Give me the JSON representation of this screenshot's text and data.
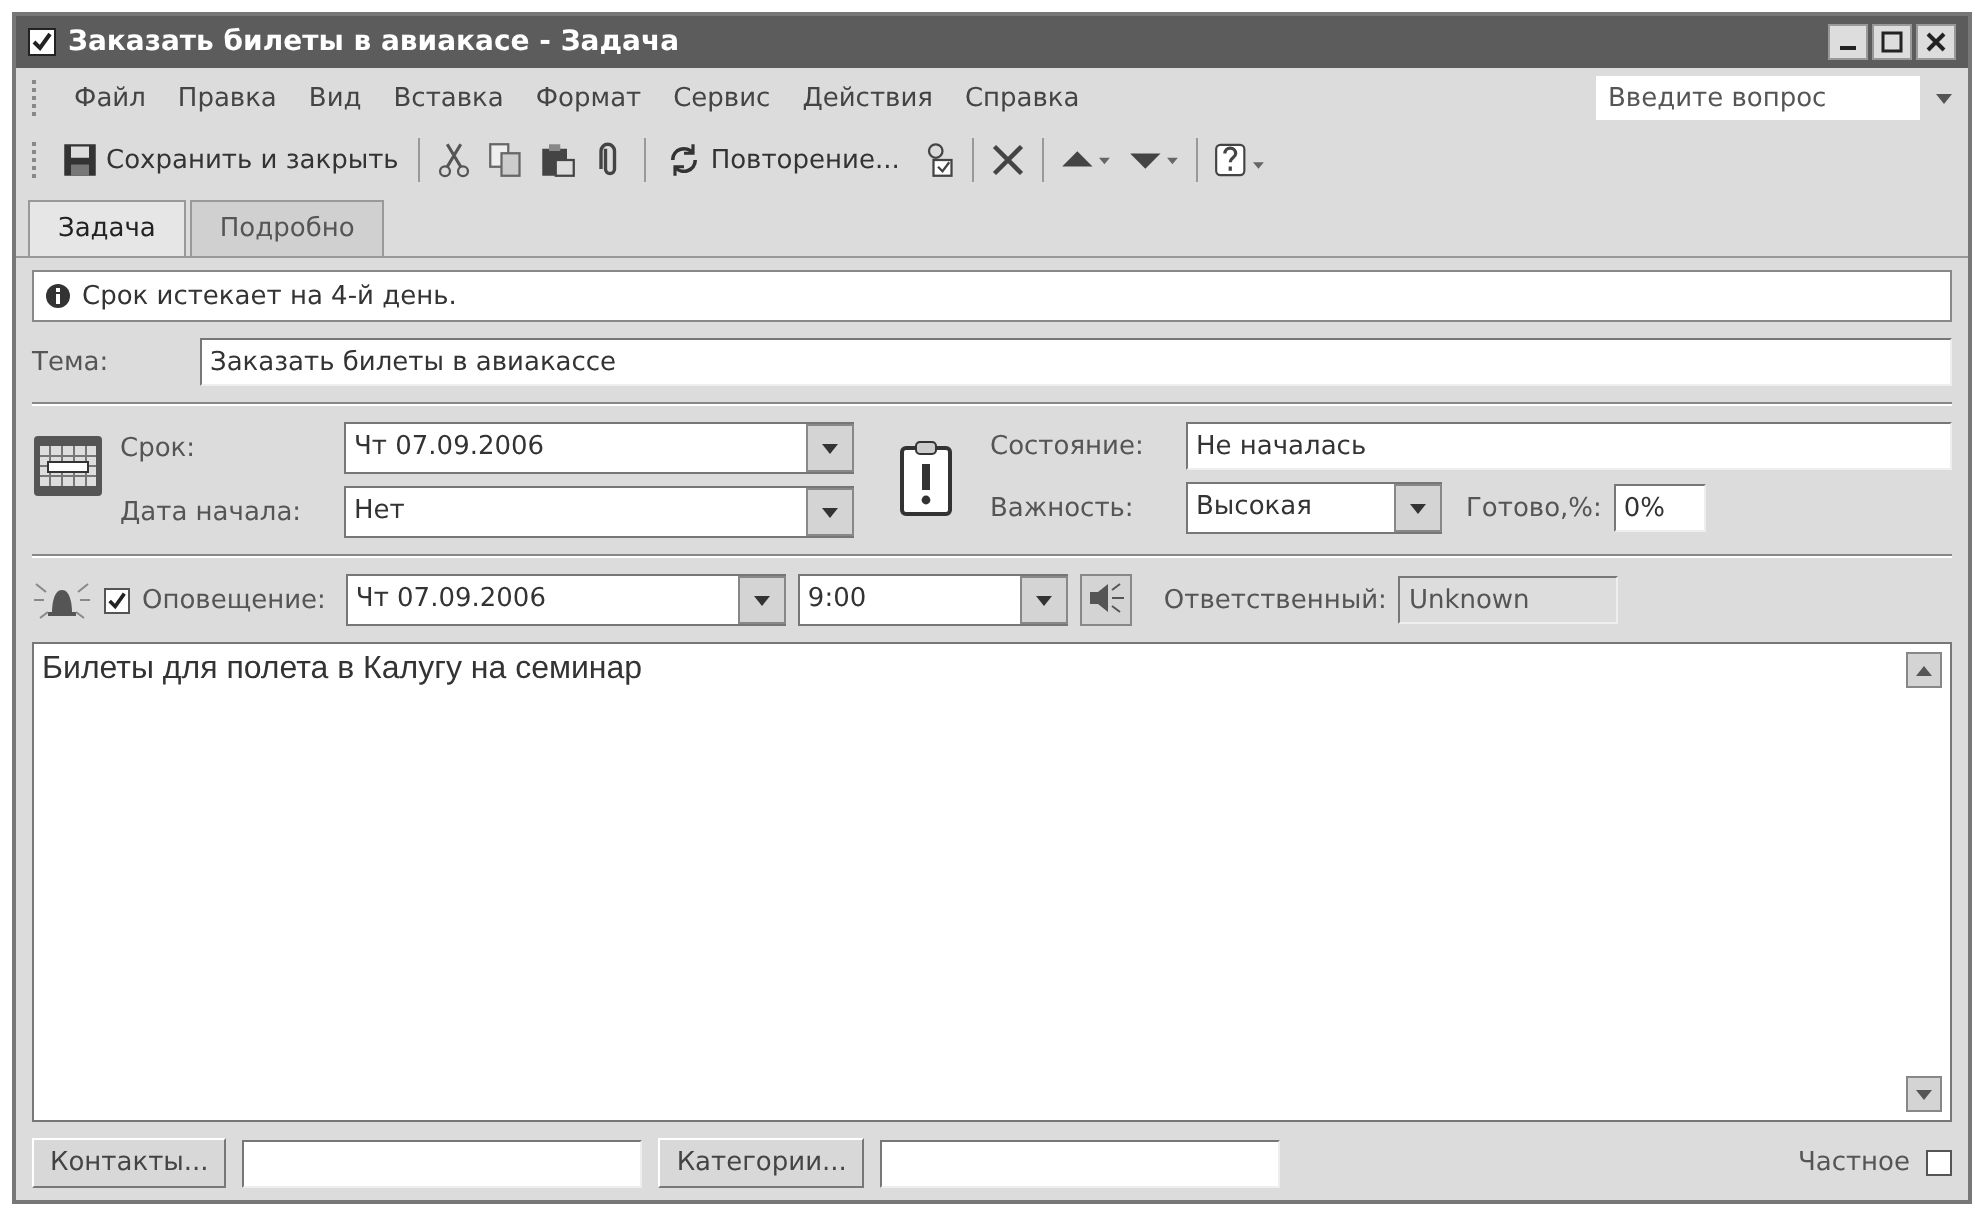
{
  "window": {
    "title": "Заказать билеты в авиакасе - Задача"
  },
  "menu": [
    "Файл",
    "Правка",
    "Вид",
    "Вставка",
    "Формат",
    "Сервис",
    "Действия",
    "Справка"
  ],
  "help_search": {
    "placeholder": "Введите вопрос"
  },
  "toolbar": {
    "save_label": "Сохранить и закрыть",
    "recurrence_label": "Повторение..."
  },
  "tabs": [
    {
      "label": "Задача",
      "selected": true
    },
    {
      "label": "Подробно",
      "selected": false
    }
  ],
  "info": "Срок истекает на 4-й день.",
  "subject": {
    "label": "Тема:",
    "value": "Заказать билеты в авиакассе"
  },
  "due": {
    "label": "Срок:",
    "value": "Чт 07.09.2006"
  },
  "start": {
    "label": "Дата начала:",
    "value": "Нет"
  },
  "status": {
    "label": "Состояние:",
    "value": "Не началась"
  },
  "priority": {
    "label": "Важность:",
    "value": "Высокая"
  },
  "complete": {
    "label": "Готово,%:",
    "value": "0%"
  },
  "reminder": {
    "label": "Оповещение:",
    "checked": true,
    "date": "Чт 07.09.2006",
    "time": "9:00"
  },
  "owner": {
    "label": "Ответственный:",
    "value": "Unknown"
  },
  "notes": "Билеты для полета в Калугу на семинар",
  "contacts_button": "Контакты...",
  "categories_button": "Категории...",
  "private": {
    "label": "Частное",
    "checked": false
  }
}
